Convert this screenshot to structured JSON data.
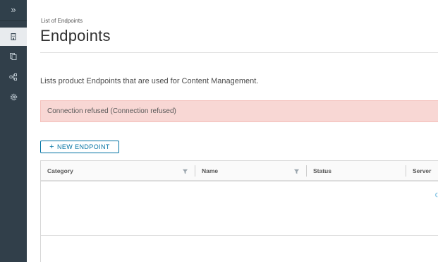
{
  "sidenav": {
    "toggle_glyph": "»",
    "items": [
      {
        "icon": "building-icon",
        "active": true
      },
      {
        "icon": "copy-icon",
        "active": false
      },
      {
        "icon": "network-icon",
        "active": false
      },
      {
        "icon": "gear-icon",
        "active": false
      }
    ]
  },
  "breadcrumb": "List of Endpoints",
  "page_title": "Endpoints",
  "description": "Lists product Endpoints that are used for Content Management.",
  "alert_message": "Connection refused (Connection refused)",
  "new_button": {
    "icon": "+",
    "label": "NEW ENDPOINT"
  },
  "table": {
    "columns": [
      "Category",
      "Name",
      "Status",
      "Server"
    ]
  },
  "colors": {
    "sidebar": "#313f4a",
    "accent": "#0072a3",
    "alert_bg": "#f8d7d4"
  }
}
